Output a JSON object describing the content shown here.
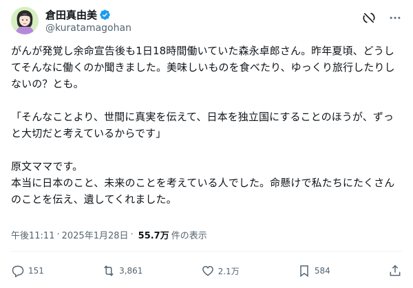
{
  "author": {
    "display_name": "倉田真由美",
    "handle": "@kuratamagohan",
    "avatar_icon": "avatar-illustration",
    "verified_icon": "verified-badge-icon",
    "verified_color": "#1d9bf0"
  },
  "tweet": {
    "text": "がんが発覚し余命宣告後も1日18時間働いていた森永卓郎さん。昨年夏頃、どうしてそんなに働くのか聞きました。美味しいものを食べたり、ゆっくり旅行したりしないの？とも。\n\n「そんなことより、世間に真実を伝えて、日本を独立国にすることのほうが、ずっと大切だと考えているからです」\n\n原文ママです。\n本当に日本のこと、未来のことを考えている人でした。命懸けで私たちにたくさんのことを伝え、遺してくれました。",
    "time": "午後11:11",
    "separator": "·",
    "date": "2025年1月28日",
    "views_count": "55.7万",
    "views_label": "件の表示"
  },
  "actions": {
    "replies": "151",
    "reposts": "3,861",
    "likes": "2.1万",
    "bookmarks": "584"
  }
}
